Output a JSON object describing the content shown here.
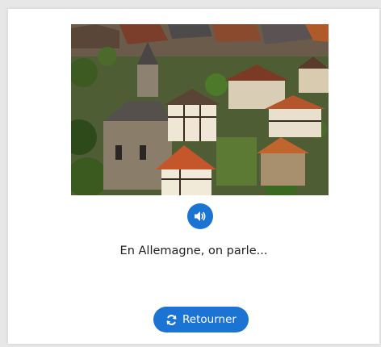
{
  "card": {
    "image_alt": "Aerial view of a German old town with half-timbered houses and church towers",
    "audio_icon": "volume-icon",
    "prompt": "En Allemagne, on parle...",
    "flip_icon": "refresh-icon",
    "flip_label": "Retourner"
  },
  "colors": {
    "accent": "#1b73d3",
    "background": "#e7e7e7",
    "card": "#ffffff"
  }
}
